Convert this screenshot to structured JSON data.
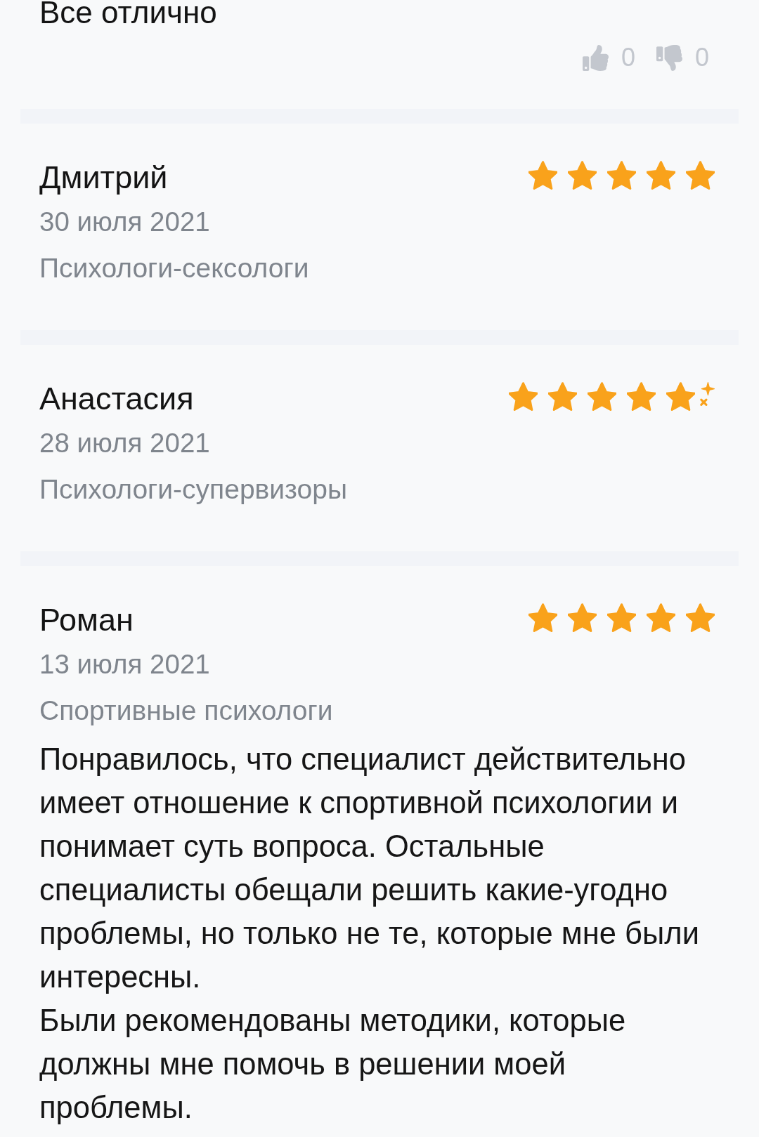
{
  "previous_review": {
    "text": "Все отлично",
    "likes": "0",
    "dislikes": "0"
  },
  "reviews": [
    {
      "name": "Дмитрий",
      "date": "30 июля 2021",
      "category": "Психологи-сексологи",
      "stars": 5,
      "sparkle": false
    },
    {
      "name": "Анастасия",
      "date": "28 июля 2021",
      "category": "Психологи-супервизоры",
      "stars": 5,
      "sparkle": true
    },
    {
      "name": "Роман",
      "date": "13 июля 2021",
      "category": "Спортивные психологи",
      "stars": 5,
      "sparkle": false,
      "text": [
        "Понравилось, что специалист действительно имеет отношение к спортивной психологии и понимает суть вопроса. Остальные специалисты обещали решить какие-угодно проблемы, но только не те, которые мне были интересны.",
        "Были рекомендованы методики, которые должны мне помочь в решении моей проблемы."
      ]
    }
  ]
}
